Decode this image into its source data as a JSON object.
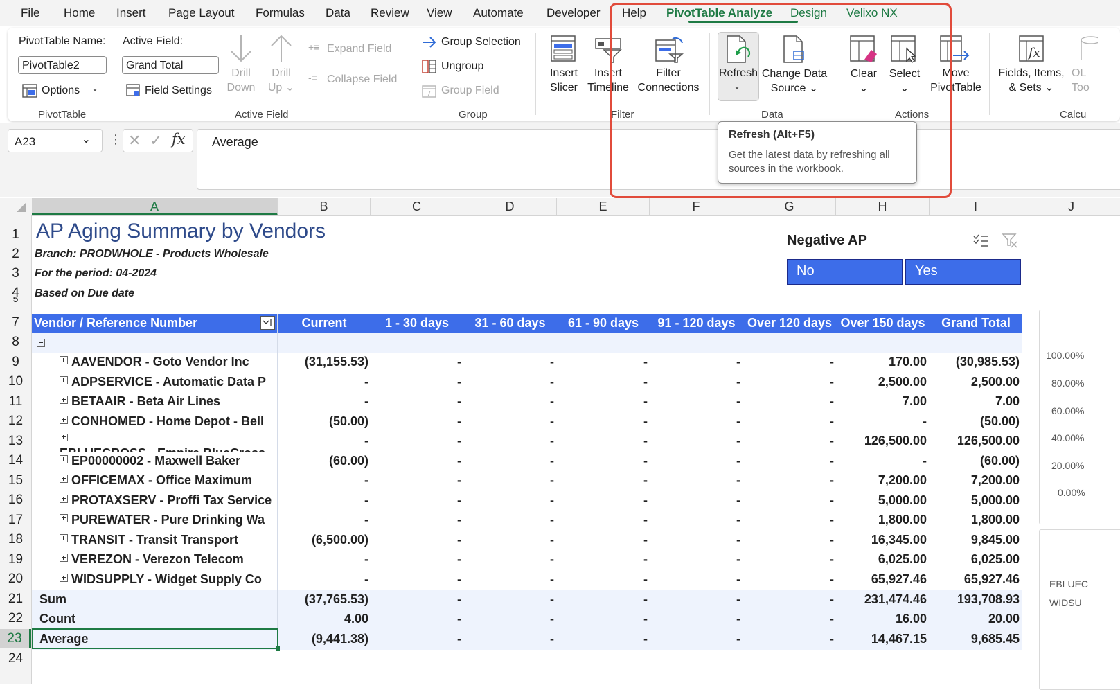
{
  "menu": {
    "items": [
      "File",
      "Home",
      "Insert",
      "Page Layout",
      "Formulas",
      "Data",
      "Review",
      "View",
      "Automate",
      "Developer",
      "Help",
      "PivotTable Analyze",
      "Design",
      "Velixo NX"
    ],
    "active": "PivotTable Analyze"
  },
  "ribbon": {
    "pivottable": {
      "name_label": "PivotTable Name:",
      "name_value": "PivotTable2",
      "options_label": "Options",
      "group_label": "PivotTable"
    },
    "active_field": {
      "label": "Active Field:",
      "value": "Grand Total",
      "field_settings": "Field Settings",
      "drill_down": [
        "Drill",
        "Down"
      ],
      "drill_up": [
        "Drill",
        "Up"
      ],
      "expand_field": "Expand Field",
      "collapse_field": "Collapse Field",
      "group_label": "Active Field"
    },
    "group": {
      "group_selection": "Group Selection",
      "ungroup": "Ungroup",
      "group_field": "Group Field",
      "group_label": "Group"
    },
    "filter": {
      "insert_slicer": [
        "Insert",
        "Slicer"
      ],
      "insert_timeline": [
        "Insert",
        "Timeline"
      ],
      "filter_connections": [
        "Filter",
        "Connections"
      ],
      "group_label": "Filter"
    },
    "data": {
      "refresh": "Refresh",
      "change_data_source": [
        "Change Data",
        "Source"
      ],
      "group_label": "Data"
    },
    "actions": {
      "clear": "Clear",
      "select": "Select",
      "move_pivottable": [
        "Move",
        "PivotTable"
      ],
      "group_label": "Actions"
    },
    "calculations": {
      "fields_items_sets": [
        "Fields, Items,",
        "& Sets"
      ],
      "olap_tools": [
        "OL",
        "Too"
      ],
      "group_label": "Calcu"
    }
  },
  "tooltip": {
    "title": "Refresh (Alt+F5)",
    "description": "Get the latest data by refreshing all sources in the workbook."
  },
  "formula_bar": {
    "name_box": "A23",
    "formula": "Average"
  },
  "columns": [
    "A",
    "B",
    "C",
    "D",
    "E",
    "F",
    "G",
    "H",
    "I",
    "J"
  ],
  "rows": [
    "1",
    "2",
    "3",
    "4",
    "5",
    "7",
    "8",
    "9",
    "10",
    "11",
    "12",
    "13",
    "14",
    "15",
    "16",
    "17",
    "18",
    "19",
    "20",
    "21",
    "22",
    "23",
    "24"
  ],
  "report": {
    "title": "AP Aging Summary by Vendors",
    "branch": "Branch: PRODWHOLE - Products Wholesale",
    "period": "For the period: 04-2024",
    "basis": "Based on Due date"
  },
  "slicer": {
    "title": "Negative AP",
    "options": [
      "No",
      "Yes"
    ]
  },
  "pivot": {
    "headers": [
      "Vendor / Reference Number",
      "Current",
      "1 - 30 days",
      "31 - 60 days",
      "61 - 90 days",
      "91 - 120 days",
      "Over 120 days",
      "Over 150 days",
      "Grand Total"
    ],
    "vendors": [
      {
        "name": "AAVENDOR - Goto Vendor Inc",
        "values": [
          "(31,155.53)",
          "-",
          "-",
          "-",
          "-",
          "-",
          "170.00",
          "(30,985.53)"
        ]
      },
      {
        "name": "ADPSERVICE - Automatic Data P",
        "values": [
          "-",
          "-",
          "-",
          "-",
          "-",
          "-",
          "2,500.00",
          "2,500.00"
        ]
      },
      {
        "name": "BETAAIR - Beta Air Lines",
        "values": [
          "-",
          "-",
          "-",
          "-",
          "-",
          "-",
          "7.00",
          "7.00"
        ]
      },
      {
        "name": "CONHOMED - Home Depot - Bell",
        "values": [
          "(50.00)",
          "-",
          "-",
          "-",
          "-",
          "-",
          "-",
          "(50.00)"
        ]
      },
      {
        "name": "EBLUECROSS - Empire BlueCross",
        "values": [
          "-",
          "-",
          "-",
          "-",
          "-",
          "-",
          "126,500.00",
          "126,500.00"
        ]
      },
      {
        "name": "EP00000002 - Maxwell Baker",
        "values": [
          "(60.00)",
          "-",
          "-",
          "-",
          "-",
          "-",
          "-",
          "(60.00)"
        ]
      },
      {
        "name": "OFFICEMAX - Office Maximum",
        "values": [
          "-",
          "-",
          "-",
          "-",
          "-",
          "-",
          "7,200.00",
          "7,200.00"
        ]
      },
      {
        "name": "PROTAXSERV - Proffi Tax Service",
        "values": [
          "-",
          "-",
          "-",
          "-",
          "-",
          "-",
          "5,000.00",
          "5,000.00"
        ]
      },
      {
        "name": "PUREWATER - Pure Drinking Wa",
        "values": [
          "-",
          "-",
          "-",
          "-",
          "-",
          "-",
          "1,800.00",
          "1,800.00"
        ]
      },
      {
        "name": "TRANSIT - Transit Transport",
        "values": [
          "(6,500.00)",
          "-",
          "-",
          "-",
          "-",
          "-",
          "16,345.00",
          "9,845.00"
        ]
      },
      {
        "name": "VEREZON - Verezon Telecom",
        "values": [
          "-",
          "-",
          "-",
          "-",
          "-",
          "-",
          "6,025.00",
          "6,025.00"
        ]
      },
      {
        "name": "WIDSUPPLY - Widget Supply Co",
        "values": [
          "-",
          "-",
          "-",
          "-",
          "-",
          "-",
          "65,927.46",
          "65,927.46"
        ]
      }
    ],
    "totals": [
      {
        "label": "Sum",
        "values": [
          "(37,765.53)",
          "-",
          "-",
          "-",
          "-",
          "-",
          "231,474.46",
          "193,708.93"
        ]
      },
      {
        "label": "Count",
        "values": [
          "4.00",
          "-",
          "-",
          "-",
          "-",
          "-",
          "16.00",
          "20.00"
        ]
      },
      {
        "label": "Average",
        "values": [
          "(9,441.38)",
          "-",
          "-",
          "-",
          "-",
          "-",
          "14,467.15",
          "9,685.45"
        ]
      }
    ]
  },
  "side_chart": {
    "axis_ticks": [
      "100.00%",
      "80.00%",
      "60.00%",
      "40.00%",
      "20.00%",
      "0.00%"
    ],
    "labels": [
      "EBLUEC",
      "WIDSU"
    ]
  },
  "colors": {
    "accent_green": "#1e7a44",
    "pivot_header_blue": "#3d6de9",
    "highlight_red": "#e14b3b",
    "title_blue": "#2e4a8a"
  }
}
